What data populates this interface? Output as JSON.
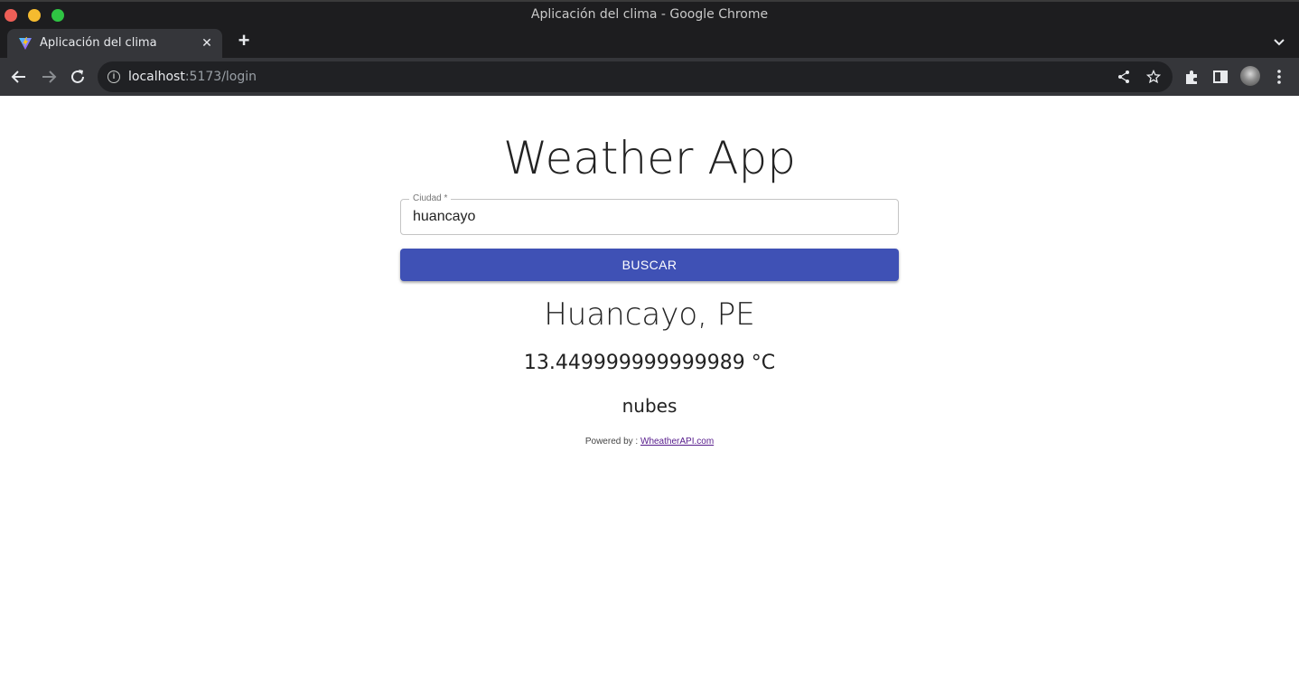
{
  "window": {
    "title": "Aplicación del clima - Google Chrome"
  },
  "tabs": [
    {
      "title": "Aplicación del clima",
      "active": true
    }
  ],
  "toolbar": {
    "url_host": "localhost",
    "url_path": ":5173/login"
  },
  "page": {
    "heading": "Weather App",
    "city_field": {
      "label": "Ciudad *",
      "value": "huancayo"
    },
    "search_button": "BUSCAR",
    "result": {
      "location": "Huancayo, PE",
      "temperature": "13.449999999999989 °C",
      "description": "nubes"
    },
    "footer": {
      "prefix": "Powered by : ",
      "link_text": "WheatherAPI.com"
    }
  },
  "colors": {
    "button": "#3f51b5",
    "titlebar": "#1d1d1f",
    "toolbar": "#35363a",
    "omnibox": "#202124"
  },
  "icons": {
    "toolbar": [
      "back-arrow-icon",
      "forward-arrow-icon",
      "reload-icon",
      "share-icon",
      "bookmark-star-icon",
      "extensions-icon",
      "side-panel-icon",
      "kebab-menu-icon"
    ]
  }
}
